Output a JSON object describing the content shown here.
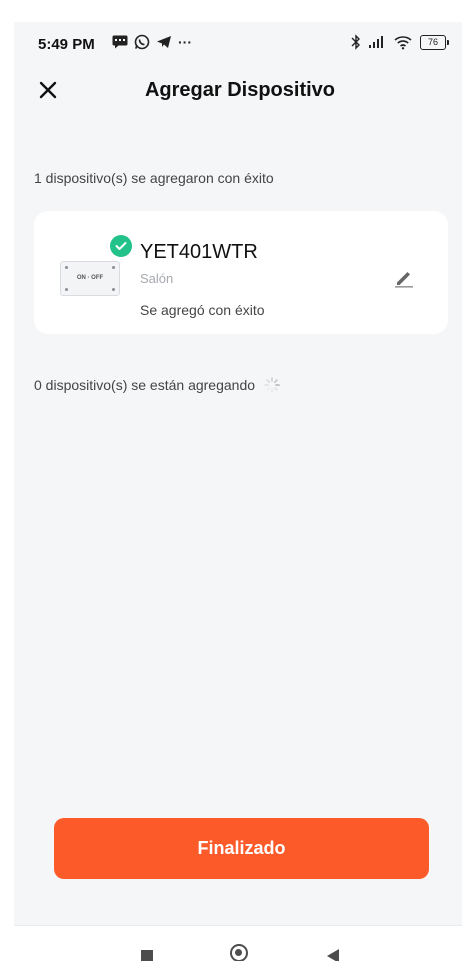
{
  "status_bar": {
    "time": "5:49 PM",
    "ellipsis": "···",
    "battery": "76"
  },
  "header": {
    "title": "Agregar Dispositivo"
  },
  "success_section": {
    "text": "1 dispositivo(s) se agregaron con éxito"
  },
  "device": {
    "name": "YET401WTR",
    "room": "Salón",
    "status": "Se agregó con éxito",
    "switch_label": "ON · OFF"
  },
  "adding_section": {
    "text": "0 dispositivo(s) se están agregando"
  },
  "footer": {
    "done_label": "Finalizado"
  },
  "colors": {
    "accent": "#fd5a2a",
    "success": "#22c28a",
    "background": "#f5f6f8"
  },
  "icons": {
    "close": "close-icon",
    "check": "check-icon",
    "edit": "pencil-icon",
    "loading": "spinner-icon"
  }
}
